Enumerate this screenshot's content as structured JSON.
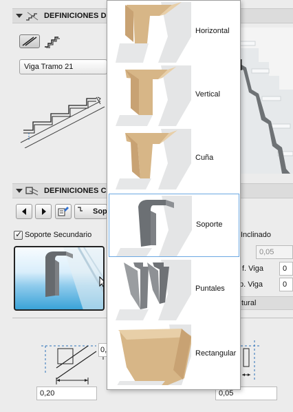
{
  "sections": {
    "stair_definitions": {
      "title": "DEFINICIONES DE"
    },
    "support_definitions": {
      "title": "DEFINICIONES CO"
    }
  },
  "stringer": {
    "type_dropdown": "Viga Tramo 21"
  },
  "support_toolbar": {
    "profile_tab_label": "Sop"
  },
  "secondary_support": {
    "checkbox_label": "Soporte Secundario",
    "checked": true
  },
  "right_panel": {
    "inclined_label": "Inclinado",
    "inclined_value": "0,05",
    "beam_label_1": "f. Viga",
    "beam_value_1": "0",
    "beam_label_2": "p. Viga",
    "beam_value_2": "0",
    "section_label": "tural"
  },
  "dimensions": {
    "bottom_left_value": "0,20",
    "bottom_right_value": "0,05",
    "side_value": "0,"
  },
  "popup": {
    "items": [
      {
        "label": "Horizontal",
        "icon": "horizontal-support-icon"
      },
      {
        "label": "Vertical",
        "icon": "vertical-support-icon"
      },
      {
        "label": "Cuña",
        "icon": "wedge-support-icon"
      },
      {
        "label": "Soporte",
        "icon": "bracket-support-icon",
        "hovered": true
      },
      {
        "label": "Puntales",
        "icon": "struts-support-icon"
      },
      {
        "label": "Rectangular",
        "icon": "rectangular-support-icon"
      }
    ]
  },
  "colors": {
    "wood": "#dcb98a",
    "metal": "#8a8a8a",
    "highlight": "#6aa7e2",
    "preview_blue": "#3aa3d8"
  }
}
